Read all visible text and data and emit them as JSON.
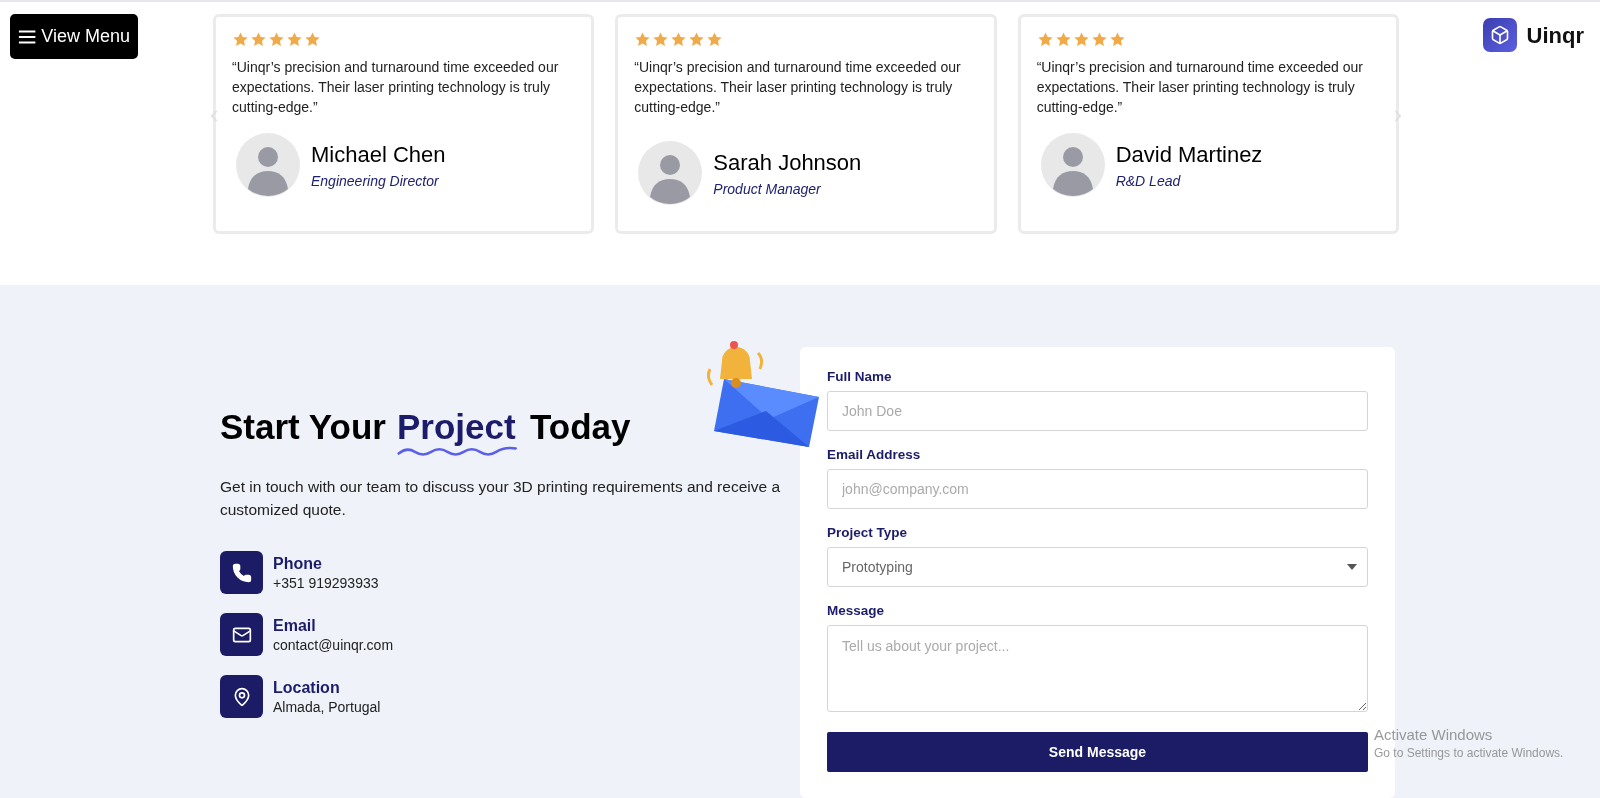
{
  "menu_button": {
    "label": "View Menu"
  },
  "brand": {
    "name": "Uinqr"
  },
  "testimonials": [
    {
      "stars": 5,
      "quote": "“Uinqr’s precision and turnaround time exceeded our expectations. Their laser printing technology is truly cutting-edge.”",
      "name": "Michael Chen",
      "role": "Engineering Director"
    },
    {
      "stars": 5,
      "quote": "“Uinqr’s precision and turnaround time exceeded our expectations. Their laser printing technology is truly cutting-edge.”",
      "name": "Sarah Johnson",
      "role": "Product Manager"
    },
    {
      "stars": 5,
      "quote": "“Uinqr’s precision and turnaround time exceeded our expectations. Their laser printing technology is truly cutting-edge.”",
      "name": "David Martinez",
      "role": "R&D Lead"
    }
  ],
  "contact": {
    "heading": {
      "before": "Start Your",
      "highlight": "Project",
      "after": "Today"
    },
    "intro": "Get in touch with our team to discuss your 3D printing requirements and receive a customized quote.",
    "items": [
      {
        "kind": "phone",
        "label": "Phone",
        "value": "+351 919293933"
      },
      {
        "kind": "email",
        "label": "Email",
        "value": "contact@uinqr.com"
      },
      {
        "kind": "location",
        "label": "Location",
        "value": "Almada, Portugal"
      }
    ]
  },
  "form": {
    "fields": [
      {
        "kind": "text",
        "label": "Full Name",
        "placeholder": "John Doe"
      },
      {
        "kind": "text",
        "label": "Email Address",
        "placeholder": "john@company.com"
      },
      {
        "kind": "select",
        "label": "Project Type",
        "value": "Prototyping"
      },
      {
        "kind": "textarea",
        "label": "Message",
        "placeholder": "Tell us about your project..."
      }
    ],
    "submit": "Send Message"
  },
  "system_overlay": {
    "title": "Activate Windows",
    "subtitle": "Go to Settings to activate Windows."
  }
}
